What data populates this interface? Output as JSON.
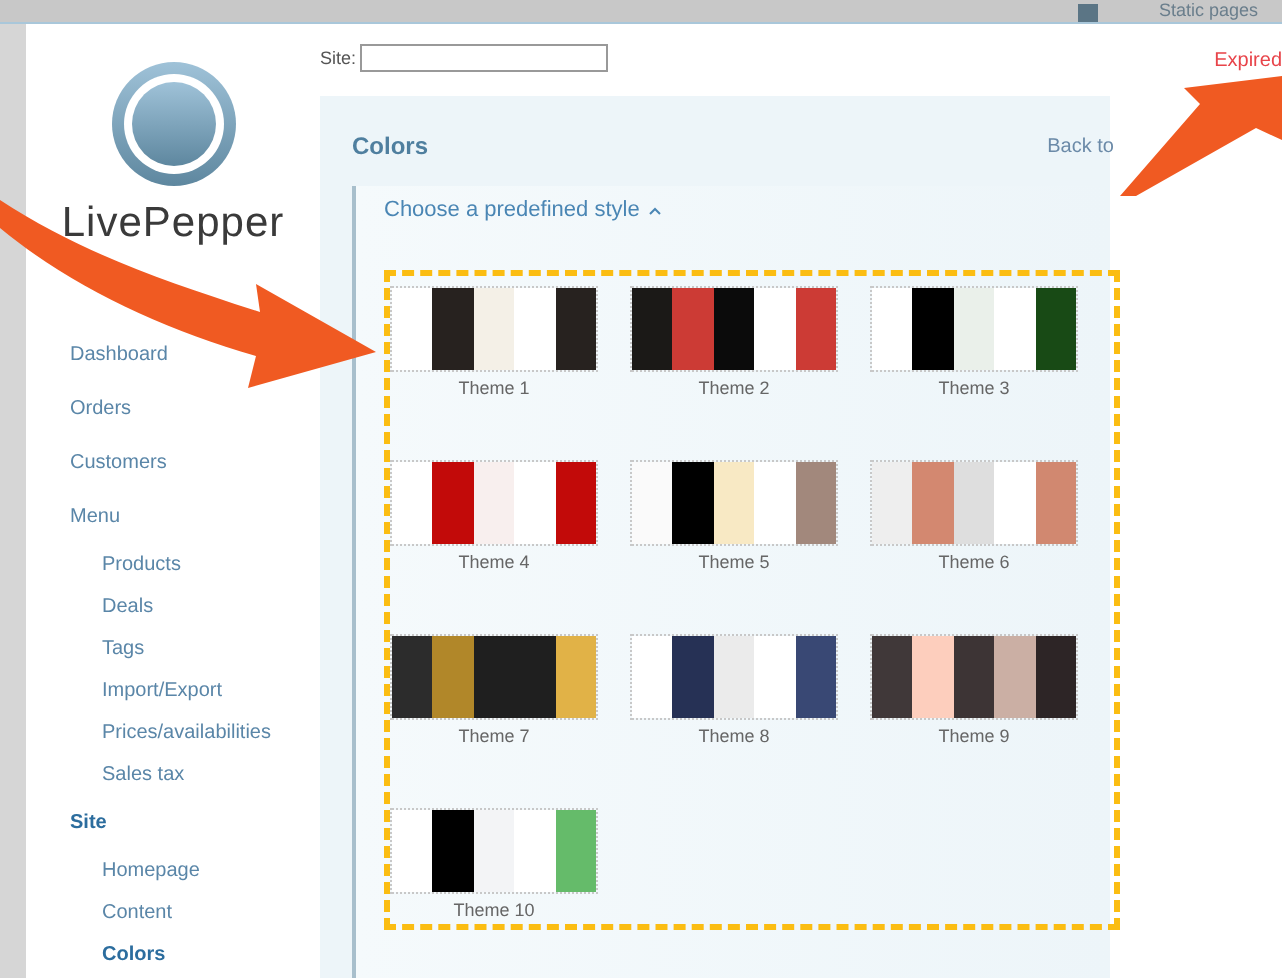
{
  "top_bar": {
    "link": "Static pages"
  },
  "logo": {
    "name": "LivePepper"
  },
  "sidebar": {
    "items": [
      {
        "label": "Dashboard",
        "selected": false
      },
      {
        "label": "Orders",
        "selected": false
      },
      {
        "label": "Customers",
        "selected": false
      },
      {
        "label": "Menu",
        "selected": false,
        "children": [
          {
            "label": "Products",
            "selected": false
          },
          {
            "label": "Deals",
            "selected": false
          },
          {
            "label": "Tags",
            "selected": false
          },
          {
            "label": "Import/Export",
            "selected": false
          },
          {
            "label": "Prices/availabilities",
            "selected": false
          },
          {
            "label": "Sales tax",
            "selected": false
          }
        ]
      },
      {
        "label": "Site",
        "selected": true,
        "children": [
          {
            "label": "Homepage",
            "selected": false
          },
          {
            "label": "Content",
            "selected": false
          },
          {
            "label": "Colors",
            "selected": true
          }
        ]
      }
    ]
  },
  "header": {
    "site_label": "Site:",
    "status": "Expired"
  },
  "panel": {
    "title": "Colors",
    "back_link": "Back to",
    "section": {
      "title": "Choose a predefined style",
      "expanded": true,
      "themes": [
        {
          "name": "Theme 1",
          "stripes": [
            {
              "color": "#ffffff"
            },
            {
              "color": "#27221f"
            },
            {
              "color": "#f4f0e7"
            },
            {
              "color": "#ffffff"
            },
            {
              "color": "#27221f"
            }
          ]
        },
        {
          "name": "Theme 2",
          "stripes": [
            {
              "color": "#1b1917"
            },
            {
              "color": "#cc3b35"
            },
            {
              "color": "#0b0b0b"
            },
            {
              "color": "#ffffff"
            },
            {
              "color": "#cc3b35"
            }
          ]
        },
        {
          "name": "Theme 3",
          "stripes": [
            {
              "color": "#ffffff"
            },
            {
              "color": "#000000"
            },
            {
              "color": "#eaf0ea"
            },
            {
              "color": "#ffffff"
            },
            {
              "color": "#184a15"
            }
          ]
        },
        {
          "name": "Theme 4",
          "stripes": [
            {
              "color": "#ffffff"
            },
            {
              "color": "#c20a09"
            },
            {
              "color": "#f8efee"
            },
            {
              "color": "#ffffff"
            },
            {
              "color": "#c20a09"
            }
          ]
        },
        {
          "name": "Theme 5",
          "stripes": [
            {
              "color": "#fafafa"
            },
            {
              "color": "#000000"
            },
            {
              "color": "#f8e9c4"
            },
            {
              "color": "#ffffff"
            },
            {
              "color": "#a2887c"
            }
          ]
        },
        {
          "name": "Theme 6",
          "stripes": [
            {
              "color": "#eeeeee"
            },
            {
              "color": "#d38870"
            },
            {
              "color": "#dedede"
            },
            {
              "color": "#ffffff"
            },
            {
              "color": "#d18870"
            }
          ]
        },
        {
          "name": "Theme 7",
          "stripes": [
            {
              "color": "#2c2c2c"
            },
            {
              "color": "#b18729"
            },
            {
              "color": "#1f1f1f"
            },
            {
              "color": "#1f1f1f"
            },
            {
              "color": "#e1b247"
            }
          ]
        },
        {
          "name": "Theme 8",
          "stripes": [
            {
              "color": "#ffffff"
            },
            {
              "color": "#263155"
            },
            {
              "color": "#ebebeb"
            },
            {
              "color": "#ffffff"
            },
            {
              "color": "#394874"
            }
          ]
        },
        {
          "name": "Theme 9",
          "stripes": [
            {
              "color": "#403839"
            },
            {
              "color": "#fdcebd"
            },
            {
              "color": "#3d3435"
            },
            {
              "color": "#cbafa4"
            },
            {
              "color": "#2d2526"
            }
          ]
        },
        {
          "name": "Theme 10",
          "stripes": [
            {
              "color": "#ffffff"
            },
            {
              "color": "#000000"
            },
            {
              "color": "#f3f4f6"
            },
            {
              "color": "#ffffff"
            },
            {
              "color": "#65bb6a"
            }
          ]
        }
      ]
    }
  }
}
